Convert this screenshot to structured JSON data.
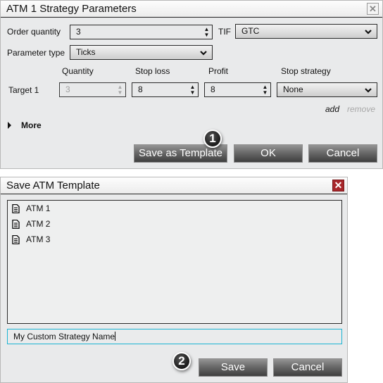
{
  "strategy_dialog": {
    "title": "ATM 1 Strategy Parameters",
    "close_icon": "close-icon",
    "order_quantity": {
      "label": "Order quantity",
      "value": "3"
    },
    "tif": {
      "label": "TIF",
      "value": "GTC"
    },
    "parameter_type": {
      "label": "Parameter type",
      "value": "Ticks"
    },
    "columns": [
      "Quantity",
      "Stop loss",
      "Profit",
      "Stop strategy"
    ],
    "targets": [
      {
        "label": "Target 1",
        "quantity": "3",
        "stop_loss": "8",
        "profit": "8",
        "stop_strategy": "None"
      }
    ],
    "add_label": "add",
    "remove_label": "remove",
    "more_label": "More",
    "buttons": {
      "save_template": "Save as Template",
      "ok": "OK",
      "cancel": "Cancel"
    },
    "step_badge": "1"
  },
  "save_dialog": {
    "title": "Save ATM Template",
    "close_icon": "close-icon",
    "templates": [
      {
        "name": "ATM 1",
        "icon": "document-icon"
      },
      {
        "name": "ATM 2",
        "icon": "document-icon"
      },
      {
        "name": "ATM 3",
        "icon": "document-icon"
      }
    ],
    "name_input": {
      "value": "My Custom Strategy Name"
    },
    "buttons": {
      "save": "Save",
      "cancel": "Cancel"
    },
    "step_badge": "2"
  },
  "colors": {
    "input_focus": "#1ab4d3",
    "close_active": "#a8262a",
    "button_dark": "#4a4a4a"
  }
}
